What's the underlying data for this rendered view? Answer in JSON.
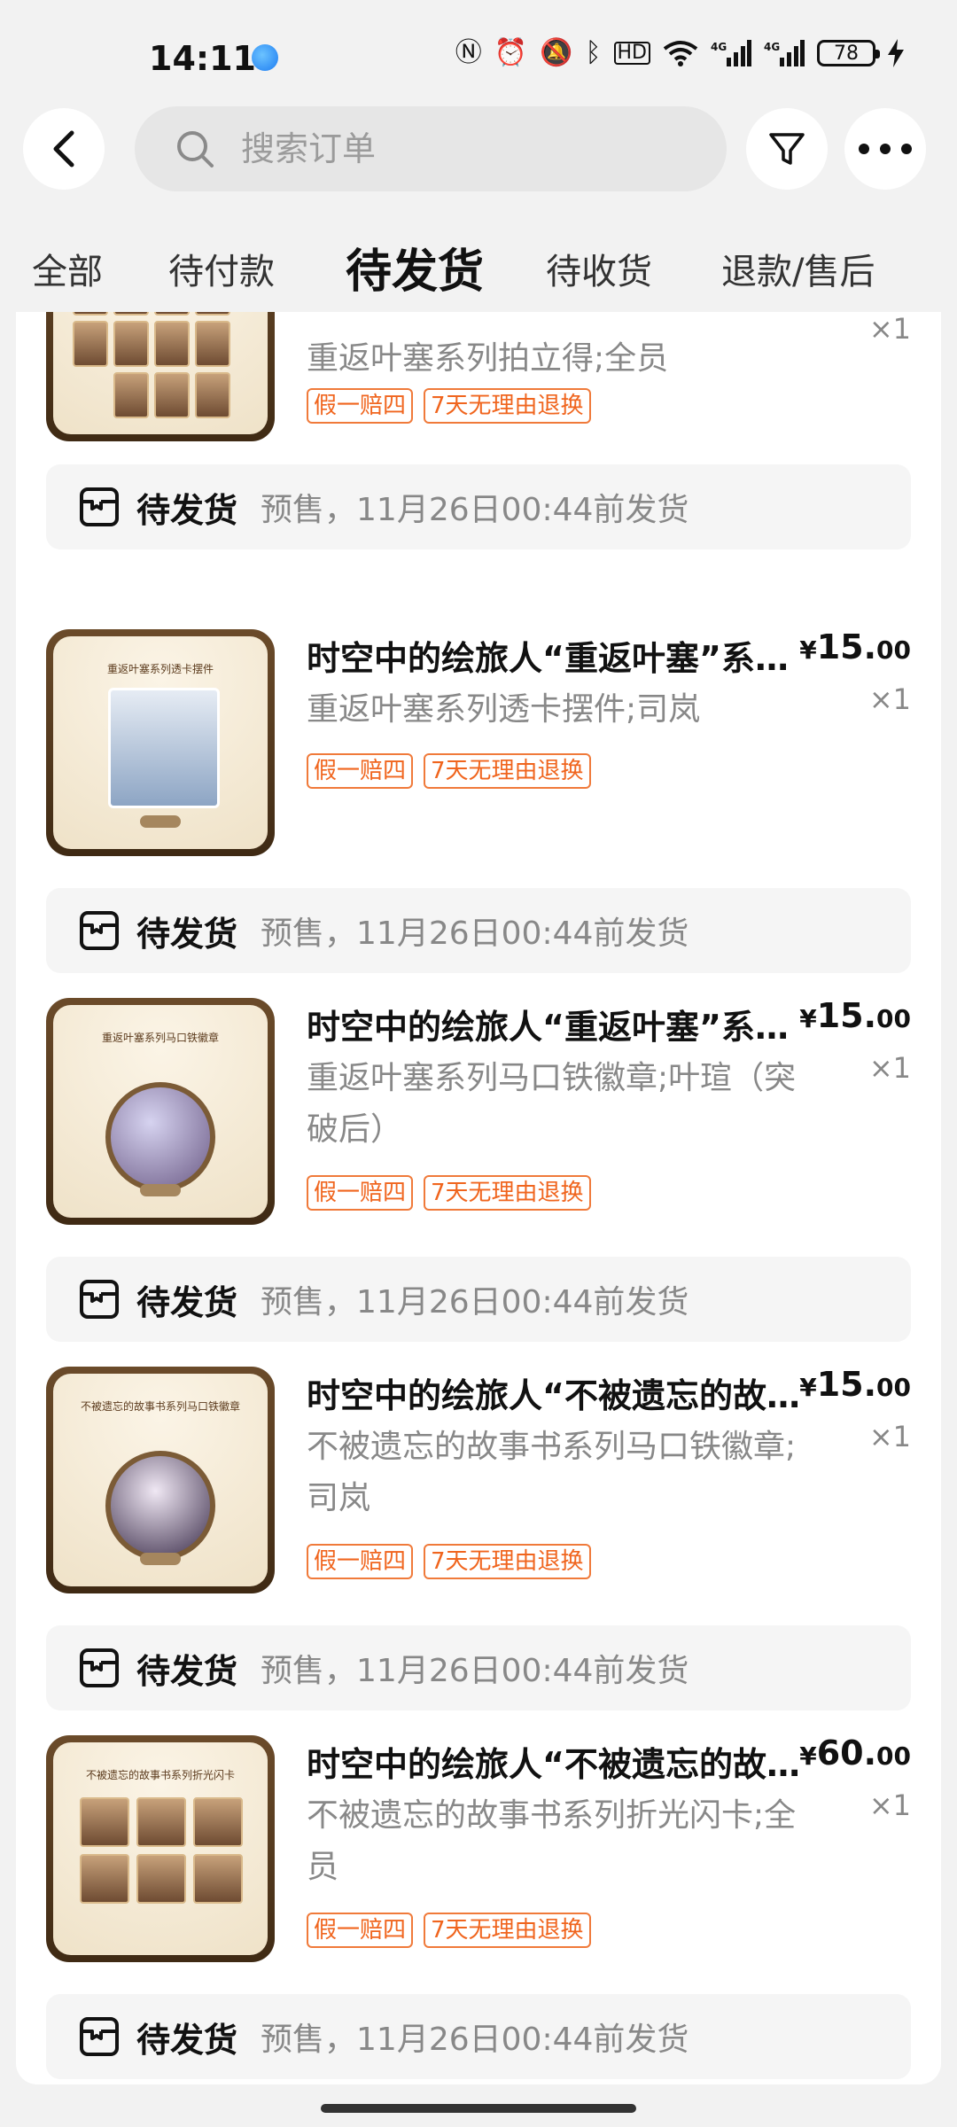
{
  "status_bar": {
    "time": "14:11",
    "battery": "78",
    "icons": [
      "nfc-icon",
      "alarm-icon",
      "mute-icon",
      "bluetooth-icon",
      "hd-icon",
      "wifi-icon",
      "signal-4g-icon",
      "signal-4g-icon",
      "battery-icon",
      "charging-icon"
    ]
  },
  "search": {
    "placeholder": "搜索订单"
  },
  "tabs": [
    {
      "label": "全部",
      "active": false
    },
    {
      "label": "待付款",
      "active": false
    },
    {
      "label": "待发货",
      "active": true
    },
    {
      "label": "待收货",
      "active": false
    },
    {
      "label": "退款/售后",
      "active": false
    }
  ],
  "orders": [
    {
      "title": "",
      "spec": "重返叶塞系列拍立得;全员",
      "qty": "×1",
      "tags": [
        "假一赔四",
        "7天无理由退换"
      ],
      "status": "待发货",
      "note": "预售，11月26日00:44前发货"
    },
    {
      "title": "时空中的绘旅人“重返叶塞”系列周边",
      "spec": "重返叶塞系列透卡摆件;司岚",
      "price_currency": "¥",
      "price_int": "15.",
      "price_dec": "00",
      "qty": "×1",
      "tags": [
        "假一赔四",
        "7天无理由退换"
      ],
      "status": "待发货",
      "note": "预售，11月26日00:44前发货",
      "thumb_title": "重返叶塞系列透卡摆件"
    },
    {
      "title": "时空中的绘旅人“重返叶塞”系列周边",
      "spec": "重返叶塞系列马口铁徽章;叶瑄（突破后）",
      "price_currency": "¥",
      "price_int": "15.",
      "price_dec": "00",
      "qty": "×1",
      "tags": [
        "假一赔四",
        "7天无理由退换"
      ],
      "status": "待发货",
      "note": "预售，11月26日00:44前发货",
      "thumb_title": "重返叶塞系列马口铁徽章"
    },
    {
      "title": "时空中的绘旅人“不被遗忘的故事书”系列",
      "spec": "不被遗忘的故事书系列马口铁徽章;司岚",
      "price_currency": "¥",
      "price_int": "15.",
      "price_dec": "00",
      "qty": "×1",
      "tags": [
        "假一赔四",
        "7天无理由退换"
      ],
      "status": "待发货",
      "note": "预售，11月26日00:44前发货",
      "thumb_title": "不被遗忘的故事书系列马口铁徽章"
    },
    {
      "title": "时空中的绘旅人“不被遗忘的故事书”系列",
      "spec": "不被遗忘的故事书系列折光闪卡;全员",
      "price_currency": "¥",
      "price_int": "60.",
      "price_dec": "00",
      "qty": "×1",
      "tags": [
        "假一赔四",
        "7天无理由退换"
      ],
      "status": "待发货",
      "note": "预售，11月26日00:44前发货",
      "thumb_title": "不被遗忘的故事书系列折光闪卡"
    }
  ],
  "colors": {
    "tag_orange": "#f0651e",
    "page_bg": "#f2f2f2",
    "card_bg": "#ffffff"
  }
}
